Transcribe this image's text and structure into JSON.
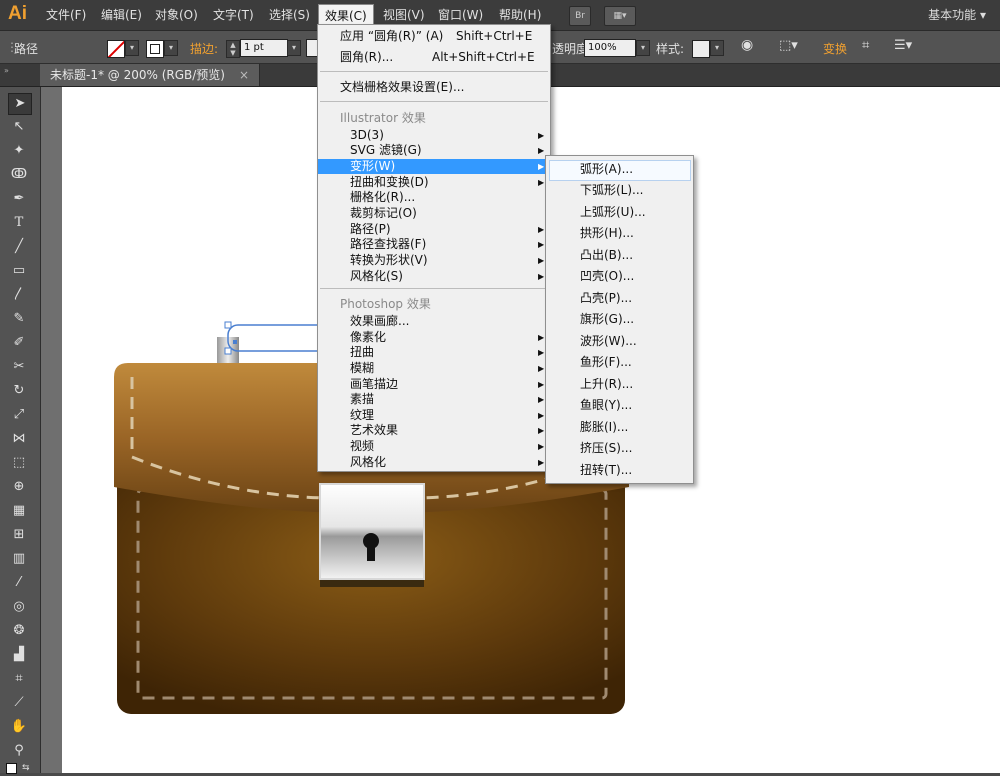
{
  "app": {
    "logo": "Ai",
    "workspace": "基本功能"
  },
  "menubar": [
    "文件(F)",
    "编辑(E)",
    "对象(O)",
    "文字(T)",
    "选择(S)",
    "效果(C)",
    "视图(V)",
    "窗口(W)",
    "帮助(H)"
  ],
  "menubar_buttons": [
    "Br"
  ],
  "options": {
    "type_label": "路径",
    "stroke_label": "描边:",
    "stroke_value": "1 pt",
    "opacity_label": "透明度:",
    "opacity_value": "100%",
    "style_label": "样式:",
    "transform_label": "变换"
  },
  "document_tab": {
    "title": "未标题-1* @ 200% (RGB/预览)",
    "close": "×"
  },
  "effect_menu": {
    "top": [
      {
        "label": "应用 “圆角(R)” (A)",
        "shortcut": "Shift+Ctrl+E"
      },
      {
        "label": "圆角(R)...",
        "shortcut": "Alt+Shift+Ctrl+E"
      }
    ],
    "doc_raster": "文档栅格效果设置(E)...",
    "illustrator_section": "Illustrator 效果",
    "illustrator_items": [
      {
        "label": "3D(3)",
        "sub": true
      },
      {
        "label": "SVG 滤镜(G)",
        "sub": true
      },
      {
        "label": "变形(W)",
        "sub": true,
        "highlight": true
      },
      {
        "label": "扭曲和变换(D)",
        "sub": true
      },
      {
        "label": "栅格化(R)...",
        "sub": false
      },
      {
        "label": "裁剪标记(O)",
        "sub": false
      },
      {
        "label": "路径(P)",
        "sub": true
      },
      {
        "label": "路径查找器(F)",
        "sub": true
      },
      {
        "label": "转换为形状(V)",
        "sub": true
      },
      {
        "label": "风格化(S)",
        "sub": true
      }
    ],
    "photoshop_section": "Photoshop 效果",
    "photoshop_items": [
      {
        "label": "效果画廊...",
        "sub": false
      },
      {
        "label": "像素化",
        "sub": true
      },
      {
        "label": "扭曲",
        "sub": true
      },
      {
        "label": "模糊",
        "sub": true
      },
      {
        "label": "画笔描边",
        "sub": true
      },
      {
        "label": "素描",
        "sub": true
      },
      {
        "label": "纹理",
        "sub": true
      },
      {
        "label": "艺术效果",
        "sub": true
      },
      {
        "label": "视频",
        "sub": true
      },
      {
        "label": "风格化",
        "sub": true
      }
    ]
  },
  "warp_submenu": [
    "弧形(A)...",
    "下弧形(L)...",
    "上弧形(U)...",
    "拱形(H)...",
    "凸出(B)...",
    "凹壳(O)...",
    "凸壳(P)...",
    "旗形(G)...",
    "波形(W)...",
    "鱼形(F)...",
    "上升(R)...",
    "鱼眼(Y)...",
    "膨胀(I)...",
    "挤压(S)...",
    "扭转(T)..."
  ]
}
